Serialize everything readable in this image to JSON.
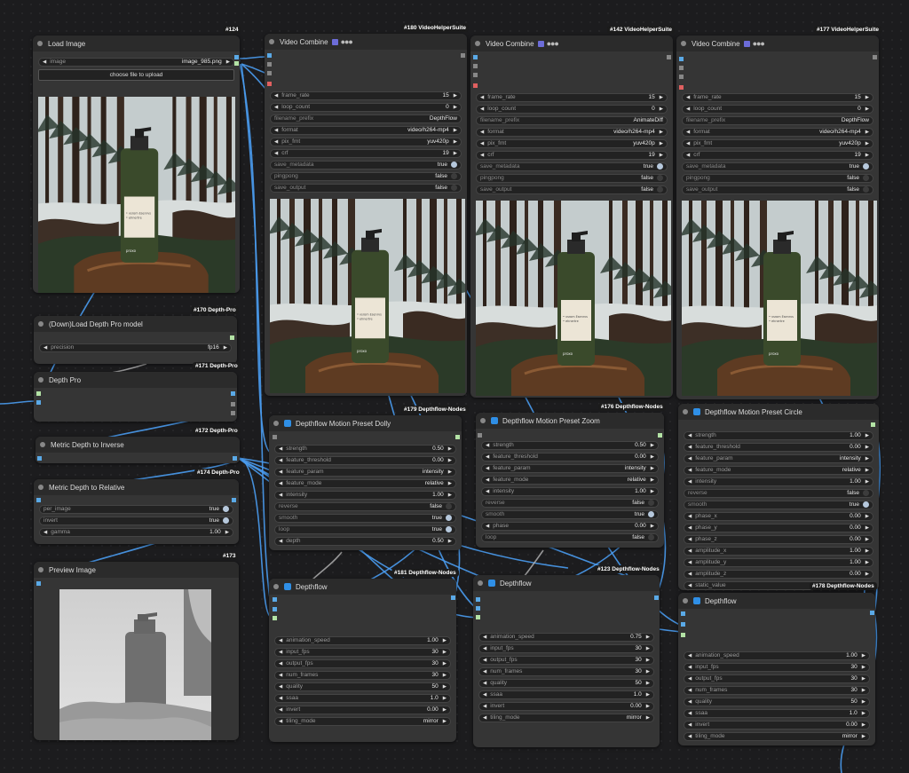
{
  "colors": {
    "canvas": "#1c1c1e",
    "node": "#353535",
    "title": "#2b2b2b",
    "wire": "#4a9cf0",
    "slot_image": "#5aa9e6",
    "slot_depth": "#b3e3a5",
    "slot_other": "#888888",
    "slot_error": "#e06060"
  },
  "badges": {
    "n124": "#124",
    "n180": "#180 VideoHelperSuite",
    "n142": "#142 VideoHelperSuite",
    "n177": "#177 VideoHelperSuite",
    "n170": "#170 Depth-Pro",
    "n171": "#171 Depth-Pro",
    "n172": "#172 Depth-Pro",
    "n174": "#174 Depth-Pro",
    "n173": "#173",
    "n179": "#179 Depthflow-Nodes",
    "n176": "#176 Depthflow-Nodes",
    "n181": "#181 Depthflow-Nodes",
    "n123": "#123 Depthflow-Nodes",
    "n178": "#178 Depthflow-Nodes"
  },
  "product": {
    "brand": "proxo",
    "label1": "• vsrom Esenrvs",
    "label2": "• ehnertre"
  },
  "load_image": {
    "title": "Load Image",
    "image_label": "image",
    "image_value": "image_985.png",
    "upload_label": "choose file to upload"
  },
  "load_depth": {
    "title": "(Down)Load Depth Pro model",
    "precision_label": "precision",
    "precision_value": "fp16"
  },
  "depth_pro": {
    "title": "Depth Pro"
  },
  "metric_inverse": {
    "title": "Metric Depth to Inverse"
  },
  "metric_relative": {
    "title": "Metric Depth to Relative",
    "widgets": [
      {
        "label": "per_image",
        "value": "true",
        "toggle": true
      },
      {
        "label": "invert",
        "value": "true",
        "toggle": true
      },
      {
        "label": "gamma",
        "value": "1.00",
        "toggle": false
      }
    ]
  },
  "preview": {
    "title": "Preview Image"
  },
  "vc180": {
    "title": "Video Combine",
    "widgets": [
      {
        "label": "frame_rate",
        "value": "15",
        "kind": "num"
      },
      {
        "label": "loop_count",
        "value": "0",
        "kind": "num"
      },
      {
        "label": "filename_prefix",
        "value": "DepthFlow",
        "kind": "text"
      },
      {
        "label": "format",
        "value": "video/h264-mp4",
        "kind": "num"
      },
      {
        "label": "pix_fmt",
        "value": "yuv420p",
        "kind": "num"
      },
      {
        "label": "crf",
        "value": "19",
        "kind": "num"
      },
      {
        "label": "save_metadata",
        "value": "true",
        "kind": "on"
      },
      {
        "label": "pingpong",
        "value": "false",
        "kind": "off"
      },
      {
        "label": "save_output",
        "value": "false",
        "kind": "off"
      }
    ]
  },
  "vc142": {
    "title": "Video Combine",
    "widgets": [
      {
        "label": "frame_rate",
        "value": "15",
        "kind": "num"
      },
      {
        "label": "loop_count",
        "value": "0",
        "kind": "num"
      },
      {
        "label": "filename_prefix",
        "value": "AnimateDiff",
        "kind": "text"
      },
      {
        "label": "format",
        "value": "video/h264-mp4",
        "kind": "num"
      },
      {
        "label": "pix_fmt",
        "value": "yuv420p",
        "kind": "num"
      },
      {
        "label": "crf",
        "value": "19",
        "kind": "num"
      },
      {
        "label": "save_metadata",
        "value": "true",
        "kind": "on"
      },
      {
        "label": "pingpong",
        "value": "false",
        "kind": "off"
      },
      {
        "label": "save_output",
        "value": "false",
        "kind": "off"
      }
    ]
  },
  "vc177": {
    "title": "Video Combine",
    "widgets": [
      {
        "label": "frame_rate",
        "value": "15",
        "kind": "num"
      },
      {
        "label": "loop_count",
        "value": "0",
        "kind": "num"
      },
      {
        "label": "filename_prefix",
        "value": "DepthFlow",
        "kind": "text"
      },
      {
        "label": "format",
        "value": "video/h264-mp4",
        "kind": "num"
      },
      {
        "label": "pix_fmt",
        "value": "yuv420p",
        "kind": "num"
      },
      {
        "label": "crf",
        "value": "19",
        "kind": "num"
      },
      {
        "label": "save_metadata",
        "value": "true",
        "kind": "on"
      },
      {
        "label": "pingpong",
        "value": "false",
        "kind": "off"
      },
      {
        "label": "save_output",
        "value": "false",
        "kind": "off"
      }
    ]
  },
  "dolly": {
    "title": "Depthflow Motion Preset Dolly",
    "widgets": [
      {
        "label": "strength",
        "value": "0.50",
        "kind": "num"
      },
      {
        "label": "feature_threshold",
        "value": "0.00",
        "kind": "num"
      },
      {
        "label": "feature_param",
        "value": "intensity",
        "kind": "num"
      },
      {
        "label": "feature_mode",
        "value": "relative",
        "kind": "num"
      },
      {
        "label": "intensity",
        "value": "1.00",
        "kind": "num"
      },
      {
        "label": "reverse",
        "value": "false",
        "kind": "off"
      },
      {
        "label": "smooth",
        "value": "true",
        "kind": "on"
      },
      {
        "label": "loop",
        "value": "true",
        "kind": "on"
      },
      {
        "label": "depth",
        "value": "0.50",
        "kind": "num"
      }
    ]
  },
  "zoom": {
    "title": "Depthflow Motion Preset Zoom",
    "widgets": [
      {
        "label": "strength",
        "value": "0.50",
        "kind": "num"
      },
      {
        "label": "feature_threshold",
        "value": "0.00",
        "kind": "num"
      },
      {
        "label": "feature_param",
        "value": "intensity",
        "kind": "num"
      },
      {
        "label": "feature_mode",
        "value": "relative",
        "kind": "num"
      },
      {
        "label": "intensity",
        "value": "1.00",
        "kind": "num"
      },
      {
        "label": "reverse",
        "value": "false",
        "kind": "off"
      },
      {
        "label": "smooth",
        "value": "true",
        "kind": "on"
      },
      {
        "label": "phase",
        "value": "0.00",
        "kind": "num"
      },
      {
        "label": "loop",
        "value": "false",
        "kind": "off"
      }
    ]
  },
  "circle": {
    "title": "Depthflow Motion Preset Circle",
    "widgets": [
      {
        "label": "strength",
        "value": "1.00",
        "kind": "num"
      },
      {
        "label": "feature_threshold",
        "value": "0.00",
        "kind": "num"
      },
      {
        "label": "feature_param",
        "value": "intensity",
        "kind": "num"
      },
      {
        "label": "feature_mode",
        "value": "relative",
        "kind": "num"
      },
      {
        "label": "intensity",
        "value": "1.00",
        "kind": "num"
      },
      {
        "label": "reverse",
        "value": "false",
        "kind": "off"
      },
      {
        "label": "smooth",
        "value": "true",
        "kind": "on"
      },
      {
        "label": "phase_x",
        "value": "0.00",
        "kind": "num"
      },
      {
        "label": "phase_y",
        "value": "0.00",
        "kind": "num"
      },
      {
        "label": "phase_z",
        "value": "0.00",
        "kind": "num"
      },
      {
        "label": "amplitude_x",
        "value": "1.00",
        "kind": "num"
      },
      {
        "label": "amplitude_y",
        "value": "1.00",
        "kind": "num"
      },
      {
        "label": "amplitude_z",
        "value": "0.00",
        "kind": "num"
      },
      {
        "label": "static_value",
        "value": "",
        "kind": "num"
      }
    ]
  },
  "df181": {
    "title": "Depthflow",
    "widgets": [
      {
        "label": "animation_speed",
        "value": "1.00",
        "kind": "num"
      },
      {
        "label": "input_fps",
        "value": "30",
        "kind": "num"
      },
      {
        "label": "output_fps",
        "value": "30",
        "kind": "num"
      },
      {
        "label": "num_frames",
        "value": "30",
        "kind": "num"
      },
      {
        "label": "quality",
        "value": "50",
        "kind": "num"
      },
      {
        "label": "ssaa",
        "value": "1.0",
        "kind": "num"
      },
      {
        "label": "invert",
        "value": "0.00",
        "kind": "num"
      },
      {
        "label": "tiling_mode",
        "value": "mirror",
        "kind": "num"
      }
    ]
  },
  "df123": {
    "title": "Depthflow",
    "widgets": [
      {
        "label": "animation_speed",
        "value": "0.75",
        "kind": "num"
      },
      {
        "label": "input_fps",
        "value": "30",
        "kind": "num"
      },
      {
        "label": "output_fps",
        "value": "30",
        "kind": "num"
      },
      {
        "label": "num_frames",
        "value": "30",
        "kind": "num"
      },
      {
        "label": "quality",
        "value": "50",
        "kind": "num"
      },
      {
        "label": "ssaa",
        "value": "1.0",
        "kind": "num"
      },
      {
        "label": "invert",
        "value": "0.00",
        "kind": "num"
      },
      {
        "label": "tiling_mode",
        "value": "mirror",
        "kind": "num"
      }
    ]
  },
  "df178": {
    "title": "Depthflow",
    "widgets": [
      {
        "label": "animation_speed",
        "value": "1.00",
        "kind": "num"
      },
      {
        "label": "input_fps",
        "value": "30",
        "kind": "num"
      },
      {
        "label": "output_fps",
        "value": "30",
        "kind": "num"
      },
      {
        "label": "num_frames",
        "value": "30",
        "kind": "num"
      },
      {
        "label": "quality",
        "value": "50",
        "kind": "num"
      },
      {
        "label": "ssaa",
        "value": "1.0",
        "kind": "num"
      },
      {
        "label": "invert",
        "value": "0.00",
        "kind": "num"
      },
      {
        "label": "tiling_mode",
        "value": "mirror",
        "kind": "num"
      }
    ]
  }
}
